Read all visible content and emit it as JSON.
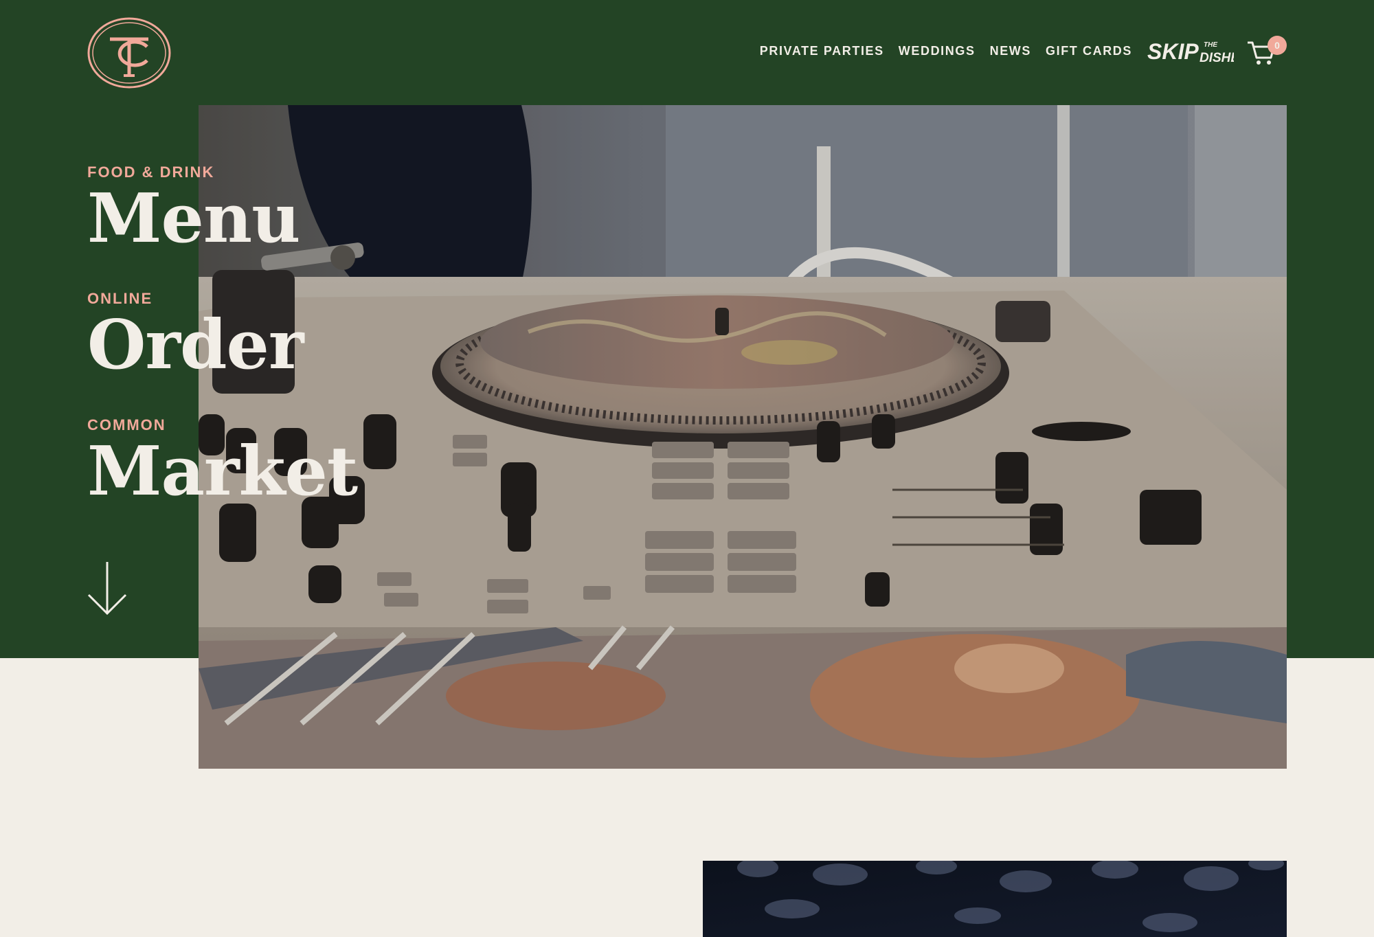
{
  "brand": {
    "logo_monogram": "TC"
  },
  "nav": {
    "items": [
      {
        "label": "PRIVATE PARTIES"
      },
      {
        "label": "WEDDINGS"
      },
      {
        "label": "NEWS"
      },
      {
        "label": "GIFT CARDS"
      }
    ],
    "skip_logo": {
      "big": "SKIP",
      "small_top": "THE",
      "small_bottom": "DISHES"
    },
    "cart_count": "0"
  },
  "sections": [
    {
      "eyebrow": "FOOD & DRINK",
      "title": "Menu"
    },
    {
      "eyebrow": "ONLINE",
      "title": "Order"
    },
    {
      "eyebrow": "COMMON",
      "title": "Market"
    }
  ],
  "colors": {
    "hero_green": "#234425",
    "cream": "#f2eee7",
    "accent_pink": "#f1a99a"
  },
  "icons": {
    "scroll": "arrow-down-icon",
    "cart": "cart-icon"
  }
}
